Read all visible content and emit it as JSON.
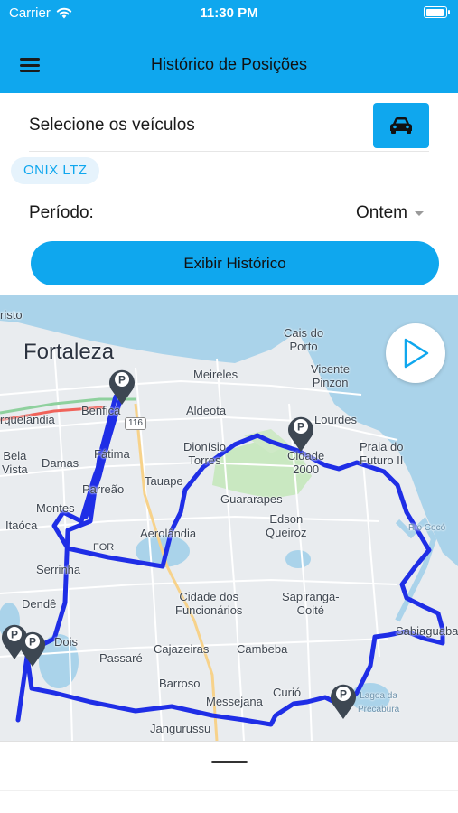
{
  "status_bar": {
    "carrier": "Carrier",
    "time": "11:30 PM"
  },
  "header": {
    "title": "Histórico de Posições",
    "menu_icon": "hamburger-icon"
  },
  "vehicles": {
    "label": "Selecione os veículos",
    "button_icon": "car-icon",
    "selected": [
      "ONIX LTZ"
    ]
  },
  "period": {
    "label": "Período:",
    "value": "Ontem"
  },
  "actions": {
    "show_history": "Exibir Histórico"
  },
  "map": {
    "play_icon": "play-icon",
    "route_color": "#1f2ee6",
    "accent_color": "#0fa7ee",
    "labels": {
      "cristo": "risto",
      "fortaleza": "Fortaleza",
      "cais": "Cais do\nPorto",
      "meireles": "Meireles",
      "vicente": "Vicente\nPinzon",
      "benfica": "Benfica",
      "aldeota": "Aldeota",
      "lourdes": "Lourdes",
      "rquelandia": "rquelândia",
      "fatima": "Fátima",
      "dionisio": "Dionísio\nTorres",
      "cidade2000": "Cidade\n2000",
      "praia": "Praia do\nFuturo II",
      "bela": "Bela\nVista",
      "damas": "Damas",
      "tauape": "Tauape",
      "parreao": "Parreão",
      "guararapes": "Guararapes",
      "edson": "Edson\nQueiroz",
      "montes": "Montes",
      "itaoca": "Itaóca",
      "for": "FOR",
      "aerolandia": "Aerolândia",
      "cocoriver": "Rio Cocó",
      "serrinha": "Serrinha",
      "dende": "Dendê",
      "cidadefunc": "Cidade dos\nFuncionários",
      "sapiranga": "Sapiranga-\nCoité",
      "sabiaguaba": "Sabiaguaba",
      "dois": "Dois",
      "passare": "Passaré",
      "cajazeiras": "Cajazeiras",
      "cambeba": "Cambeba",
      "barroso": "Barroso",
      "messejana": "Messejana",
      "curio": "Curió",
      "lagoa": "Lagoa da\nPrecabura",
      "jangurussu": "Jangurussu",
      "hwy116": "116"
    }
  }
}
